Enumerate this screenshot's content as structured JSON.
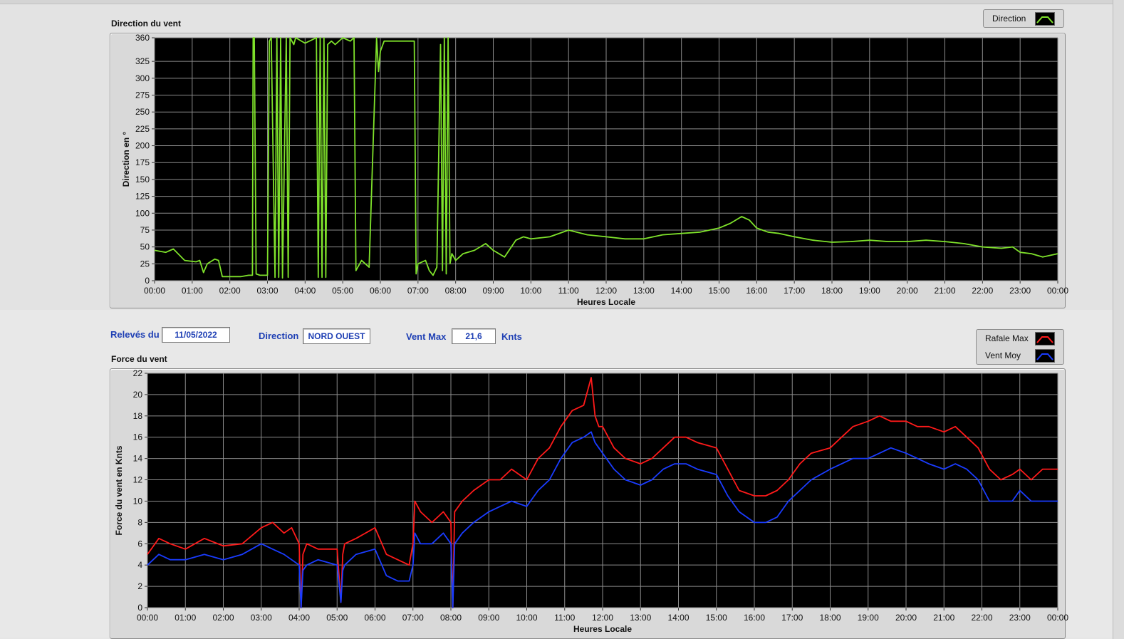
{
  "top_chart": {
    "title": "Direction du vent",
    "legend": [
      {
        "label": "Direction",
        "color": "#7fe22b",
        "icon": "line-swatch-icon"
      }
    ]
  },
  "bottom_chart": {
    "title": "Force du vent",
    "legend": [
      {
        "label": "Rafale Max",
        "color": "#ff1a1a",
        "icon": "line-swatch-icon"
      },
      {
        "label": "Vent Moy",
        "color": "#1a3cff",
        "icon": "line-swatch-icon"
      }
    ]
  },
  "info": {
    "date_label": "Relevés du",
    "date_value": "11/05/2022",
    "direction_label": "Direction",
    "direction_value": "NORD OUEST",
    "vent_max_label": "Vent Max",
    "vent_max_value": "21,6",
    "vent_max_unit": "Knts"
  },
  "colors": {
    "plot_bg": "#000000",
    "grid": "#8c8c8c",
    "accent_text": "#1e3fb4"
  },
  "chart_data": [
    {
      "type": "line",
      "title": "Direction du vent",
      "xlabel": "Heures Locale",
      "ylabel": "Direction en °",
      "xlim": [
        0,
        24
      ],
      "ylim": [
        0,
        360
      ],
      "xticks": [
        "00:00",
        "01:00",
        "02:00",
        "03:00",
        "04:00",
        "05:00",
        "06:00",
        "07:00",
        "08:00",
        "09:00",
        "10:00",
        "11:00",
        "12:00",
        "13:00",
        "14:00",
        "15:00",
        "16:00",
        "17:00",
        "18:00",
        "19:00",
        "20:00",
        "21:00",
        "22:00",
        "23:00",
        "00:00"
      ],
      "yticks": [
        0,
        25,
        50,
        75,
        100,
        125,
        150,
        175,
        200,
        225,
        250,
        275,
        300,
        325,
        360
      ],
      "grid": true,
      "legend_position": "top-right",
      "series": [
        {
          "name": "Direction",
          "color": "#7fe22b",
          "x": [
            0,
            0.3,
            0.5,
            0.8,
            1.1,
            1.2,
            1.3,
            1.4,
            1.6,
            1.7,
            1.8,
            2.0,
            2.3,
            2.5,
            2.6,
            2.62,
            2.65,
            2.7,
            2.8,
            3.0,
            3.05,
            3.1,
            3.2,
            3.25,
            3.3,
            3.35,
            3.4,
            3.5,
            3.55,
            3.6,
            3.7,
            3.75,
            4.0,
            4.3,
            4.35,
            4.4,
            4.45,
            4.5,
            4.55,
            4.6,
            4.7,
            4.8,
            5.0,
            5.2,
            5.3,
            5.35,
            5.5,
            5.7,
            5.9,
            5.95,
            6.0,
            6.1,
            6.3,
            6.5,
            6.9,
            6.95,
            7.0,
            7.2,
            7.3,
            7.4,
            7.5,
            7.6,
            7.65,
            7.7,
            7.75,
            7.8,
            7.85,
            7.9,
            8.0,
            8.2,
            8.5,
            8.8,
            9.0,
            9.3,
            9.6,
            9.8,
            10.0,
            10.5,
            11.0,
            11.5,
            12.0,
            12.5,
            13.0,
            13.5,
            14.0,
            14.5,
            15.0,
            15.3,
            15.6,
            15.8,
            16.0,
            16.3,
            16.6,
            17.0,
            17.5,
            18.0,
            18.5,
            19.0,
            19.5,
            20.0,
            20.5,
            21.0,
            21.5,
            22.0,
            22.5,
            22.8,
            23.0,
            23.3,
            23.6,
            24.0
          ],
          "y": [
            45,
            42,
            47,
            30,
            28,
            30,
            12,
            25,
            32,
            30,
            6,
            6,
            6,
            8,
            8,
            360,
            360,
            10,
            8,
            8,
            355,
            360,
            5,
            360,
            5,
            360,
            4,
            360,
            5,
            360,
            350,
            360,
            352,
            360,
            5,
            360,
            5,
            360,
            5,
            350,
            355,
            350,
            360,
            355,
            360,
            15,
            30,
            20,
            360,
            310,
            340,
            355,
            355,
            355,
            355,
            10,
            25,
            30,
            15,
            8,
            20,
            350,
            15,
            360,
            10,
            360,
            25,
            40,
            30,
            40,
            45,
            55,
            45,
            35,
            60,
            65,
            62,
            65,
            75,
            68,
            65,
            62,
            62,
            68,
            70,
            72,
            78,
            85,
            95,
            90,
            78,
            72,
            70,
            65,
            60,
            57,
            58,
            60,
            58,
            58,
            60,
            58,
            55,
            50,
            48,
            50,
            42,
            40,
            35,
            40
          ]
        }
      ]
    },
    {
      "type": "line",
      "title": "Force du vent",
      "xlabel": "Heures Locale",
      "ylabel": "Force du vent en Knts",
      "xlim": [
        0,
        24
      ],
      "ylim": [
        0,
        22
      ],
      "xticks": [
        "00:00",
        "01:00",
        "02:00",
        "03:00",
        "04:00",
        "05:00",
        "06:00",
        "07:00",
        "08:00",
        "09:00",
        "10:00",
        "11:00",
        "12:00",
        "13:00",
        "14:00",
        "15:00",
        "16:00",
        "17:00",
        "18:00",
        "19:00",
        "20:00",
        "21:00",
        "22:00",
        "23:00",
        "00:00"
      ],
      "yticks": [
        0,
        2,
        4,
        6,
        8,
        10,
        12,
        14,
        16,
        18,
        20,
        22
      ],
      "grid": true,
      "legend_position": "top-right",
      "series": [
        {
          "name": "Rafale Max",
          "color": "#ff1a1a",
          "x": [
            0,
            0.3,
            0.6,
            1.0,
            1.5,
            2.0,
            2.5,
            3.0,
            3.3,
            3.6,
            3.8,
            4.0,
            4.05,
            4.1,
            4.2,
            4.5,
            5.0,
            5.1,
            5.15,
            5.2,
            5.5,
            6.0,
            6.3,
            6.6,
            6.9,
            7.0,
            7.05,
            7.2,
            7.5,
            7.8,
            8.0,
            8.05,
            8.1,
            8.3,
            8.6,
            9.0,
            9.3,
            9.6,
            10.0,
            10.3,
            10.6,
            10.9,
            11.2,
            11.5,
            11.7,
            11.8,
            11.9,
            12.0,
            12.3,
            12.6,
            13.0,
            13.3,
            13.6,
            13.9,
            14.2,
            14.5,
            15.0,
            15.3,
            15.6,
            16.0,
            16.3,
            16.6,
            16.9,
            17.2,
            17.5,
            18.0,
            18.3,
            18.6,
            19.0,
            19.3,
            19.6,
            20.0,
            20.3,
            20.6,
            21.0,
            21.3,
            21.6,
            21.9,
            22.2,
            22.5,
            22.8,
            23.0,
            23.3,
            23.6,
            24.0
          ],
          "y": [
            5,
            6.5,
            6,
            5.5,
            6.5,
            5.8,
            6,
            7.5,
            8,
            7,
            7.5,
            6,
            0,
            5,
            6,
            5.5,
            5.5,
            0.5,
            5,
            6,
            6.5,
            7.5,
            5,
            4.5,
            4,
            6,
            10,
            9,
            8,
            9,
            8,
            0,
            9,
            10,
            11,
            12,
            12,
            13,
            12,
            14,
            15,
            17,
            18.5,
            19,
            21.6,
            18,
            17,
            17,
            15,
            14,
            13.5,
            14,
            15,
            16,
            16,
            15.5,
            15,
            13,
            11,
            10.5,
            10.5,
            11,
            12,
            13.5,
            14.5,
            15,
            16,
            17,
            17.5,
            18,
            17.5,
            17.5,
            17,
            17,
            16.5,
            17,
            16,
            15,
            13,
            12,
            12.5,
            13,
            12,
            13,
            13
          ]
        },
        {
          "name": "Vent Moy",
          "color": "#1a3cff",
          "x": [
            0,
            0.3,
            0.6,
            1.0,
            1.5,
            2.0,
            2.5,
            3.0,
            3.3,
            3.6,
            3.8,
            4.0,
            4.05,
            4.1,
            4.2,
            4.5,
            5.0,
            5.1,
            5.15,
            5.2,
            5.5,
            6.0,
            6.3,
            6.6,
            6.9,
            7.0,
            7.05,
            7.2,
            7.5,
            7.8,
            8.0,
            8.05,
            8.1,
            8.3,
            8.6,
            9.0,
            9.3,
            9.6,
            10.0,
            10.3,
            10.6,
            10.9,
            11.2,
            11.5,
            11.7,
            11.8,
            11.9,
            12.0,
            12.3,
            12.6,
            13.0,
            13.3,
            13.6,
            13.9,
            14.2,
            14.5,
            15.0,
            15.3,
            15.6,
            16.0,
            16.3,
            16.6,
            16.9,
            17.2,
            17.5,
            18.0,
            18.3,
            18.6,
            19.0,
            19.3,
            19.6,
            20.0,
            20.3,
            20.6,
            21.0,
            21.3,
            21.6,
            21.9,
            22.2,
            22.5,
            22.8,
            23.0,
            23.3,
            23.6,
            24.0
          ],
          "y": [
            4,
            5,
            4.5,
            4.5,
            5,
            4.5,
            5,
            6,
            5.5,
            5,
            4.5,
            4,
            0,
            3.5,
            4,
            4.5,
            4,
            0.5,
            3.5,
            4,
            5,
            5.5,
            3,
            2.5,
            2.5,
            4,
            7,
            6,
            6,
            7,
            6,
            0,
            6,
            7,
            8,
            9,
            9.5,
            10,
            9.5,
            11,
            12,
            14,
            15.5,
            16,
            16.5,
            15.5,
            15,
            14.5,
            13,
            12,
            11.5,
            12,
            13,
            13.5,
            13.5,
            13,
            12.5,
            10.5,
            9,
            8,
            8,
            8.5,
            10,
            11,
            12,
            13,
            13.5,
            14,
            14,
            14.5,
            15,
            14.5,
            14,
            13.5,
            13,
            13.5,
            13,
            12,
            10,
            10,
            10,
            11,
            10,
            10,
            10
          ]
        }
      ]
    }
  ]
}
